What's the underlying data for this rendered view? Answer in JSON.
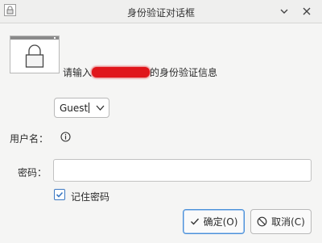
{
  "window": {
    "title": "身份验证对话框",
    "minimize_icon": "chevron-down-icon",
    "close_icon": "close-icon",
    "app_icon": "lock-icon"
  },
  "prompt": {
    "prefix": "请输入",
    "suffix": "的身份验证信息"
  },
  "identity_select": {
    "value": "Guest"
  },
  "username": {
    "label": "用户名：",
    "value_icon": "info-icon"
  },
  "password": {
    "label": "密码：",
    "value": ""
  },
  "remember": {
    "label": "记住密码",
    "checked": true
  },
  "buttons": {
    "ok_label": "确定(O)",
    "cancel_label": "取消(C)"
  },
  "colors": {
    "accent": "#3b78c2",
    "redaction": "#e0161b"
  }
}
